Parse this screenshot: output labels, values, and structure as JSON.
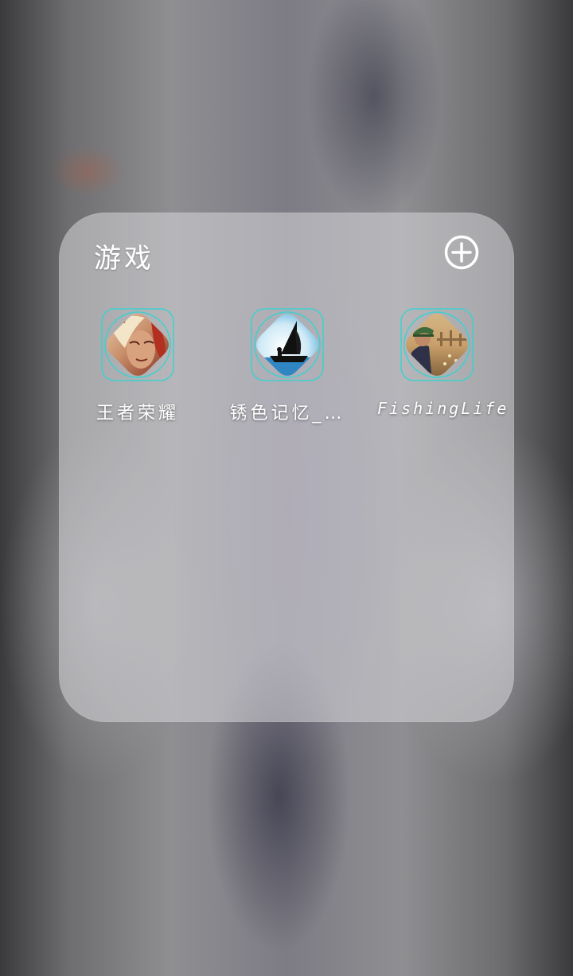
{
  "folder": {
    "title": "游戏",
    "add_icon": "plus-circle-icon"
  },
  "apps": [
    {
      "label": "王者荣耀",
      "icon": "honor-of-kings-icon"
    },
    {
      "label": "锈色记忆_…",
      "icon": "rusty-memory-icon"
    },
    {
      "label": "FishingLife",
      "icon": "fishing-life-icon"
    }
  ],
  "colors": {
    "frame_outline": "#3fd0cf",
    "folder_bg": "#d7d7da",
    "text": "#ffffff"
  }
}
